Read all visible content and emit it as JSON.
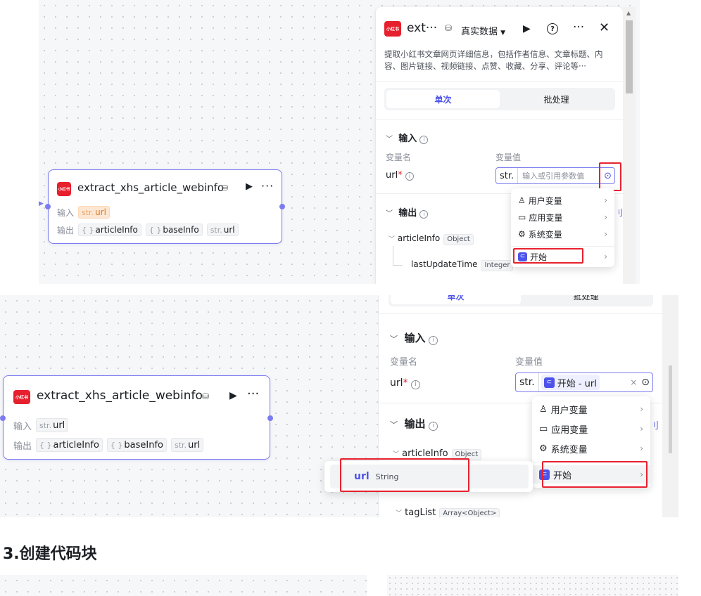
{
  "top": {
    "node": {
      "title": "extract_xhs_article_webinfo",
      "logo_text": "小红书",
      "input_label": "输入",
      "output_label": "输出",
      "inputs": [
        {
          "pre": "str.",
          "name": "url"
        }
      ],
      "outputs": [
        {
          "pre": "{ }",
          "name": "articleInfo"
        },
        {
          "pre": "{ }",
          "name": "baseInfo"
        },
        {
          "pre": "str.",
          "name": "url"
        }
      ]
    },
    "panel": {
      "title": "ext···",
      "data_mode": "真实数据",
      "description": "提取小红书文章网页详细信息，包括作者信息、文章标题、内容、图片链接、视频链接、点赞、收藏、分享、评论等···",
      "tabs": [
        "单次",
        "批处理"
      ],
      "input_section": "输入",
      "col_name": "变量名",
      "col_value": "变量值",
      "param_name": "url",
      "required_mark": "*",
      "str_prefix": "str.",
      "placeholder": "输入或引用参数值",
      "output_section": "输出",
      "tree": [
        {
          "name": "articleInfo",
          "type": "Object"
        },
        {
          "name": "lastUpdateTime",
          "type": "Integer"
        }
      ],
      "menu": [
        {
          "icon": "user-icon",
          "label": "用户变量"
        },
        {
          "icon": "app-icon",
          "label": "应用变量"
        },
        {
          "icon": "gear-icon",
          "label": "系统变量"
        },
        {
          "icon": "start-icon",
          "label": "开始"
        }
      ]
    }
  },
  "bottom": {
    "node": {
      "title": "extract_xhs_article_webinfo",
      "logo_text": "小红书",
      "input_label": "输入",
      "output_label": "输出",
      "inputs": [
        {
          "pre": "str.",
          "name": "url"
        }
      ],
      "outputs": [
        {
          "pre": "{ }",
          "name": "articleInfo"
        },
        {
          "pre": "{ }",
          "name": "baseInfo"
        },
        {
          "pre": "str.",
          "name": "url"
        }
      ]
    },
    "panel": {
      "tabs_partial": [
        "单次",
        "批处理"
      ],
      "input_section": "输入",
      "col_name": "变量名",
      "col_value": "变量值",
      "param_name": "url",
      "required_mark": "*",
      "str_prefix": "str.",
      "selected_ref": "开始 - url",
      "clear": "×",
      "output_section": "输出",
      "tree": [
        {
          "name": "articleInfo",
          "type": "Object"
        },
        {
          "name": "tagList",
          "type": "Array<Object>"
        }
      ],
      "menu": [
        {
          "icon": "user-icon",
          "label": "用户变量"
        },
        {
          "icon": "app-icon",
          "label": "应用变量"
        },
        {
          "icon": "gear-icon",
          "label": "系统变量"
        },
        {
          "icon": "start-icon",
          "label": "开始"
        }
      ],
      "submenu": {
        "name": "url",
        "type": "String"
      }
    }
  },
  "section_heading": "3.创建代码块",
  "colors": {
    "accent": "#4d53e8",
    "node_border": "#7b7cf0",
    "highlight": "#e8222f",
    "logo": "#e6202d"
  }
}
